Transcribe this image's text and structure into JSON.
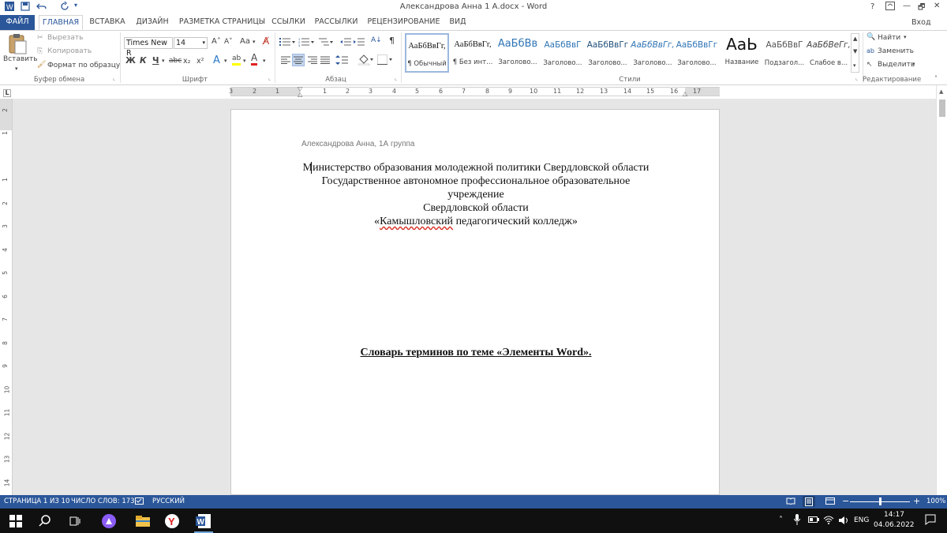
{
  "window": {
    "title": "Александрова Анна 1 А.docx - Word",
    "help": "?",
    "minimize": "—",
    "restore": "🗗",
    "close": "✕",
    "sign_in": "Вход"
  },
  "tabs": [
    "ФАЙЛ",
    "ГЛАВНАЯ",
    "ВСТАВКА",
    "ДИЗАЙН",
    "РАЗМЕТКА СТРАНИЦЫ",
    "ССЫЛКИ",
    "РАССЫЛКИ",
    "РЕЦЕНЗИРОВАНИЕ",
    "ВИД"
  ],
  "clipboard": {
    "paste": "Вставить",
    "cut": "Вырезать",
    "copy": "Копировать",
    "format_painter": "Формат по образцу",
    "label": "Буфер обмена"
  },
  "font": {
    "name": "Times New R",
    "size": "14",
    "grow": "A˄",
    "shrink": "A˅",
    "case": "Aa",
    "bold": "Ж",
    "italic": "К",
    "underline": "Ч",
    "strike": "abc",
    "subscript": "x₂",
    "superscript": "x²",
    "effects": "A",
    "highlight": "ab",
    "color": "A",
    "label": "Шрифт"
  },
  "paragraph": {
    "label": "Абзац",
    "pilcrow": "¶",
    "sort": "A↓"
  },
  "styles": {
    "label": "Стили",
    "items": [
      {
        "sample": "АаБбВвГг,",
        "name": "¶ Обычный"
      },
      {
        "sample": "АаБбВвГг,",
        "name": "¶ Без инт..."
      },
      {
        "sample": "АаБбВв",
        "name": "Заголово..."
      },
      {
        "sample": "АаБбВвГ",
        "name": "Заголово..."
      },
      {
        "sample": "АаБбВвГг",
        "name": "Заголово..."
      },
      {
        "sample": "АаБбВвГг,",
        "name": "Заголово..."
      },
      {
        "sample": "АаБбВвГг",
        "name": "Заголово..."
      },
      {
        "sample": "АаЬ",
        "name": "Название"
      },
      {
        "sample": "АаБбВвГ",
        "name": "Подзагол..."
      },
      {
        "sample": "АаБбВеГг,",
        "name": "Слабое в..."
      }
    ]
  },
  "editing": {
    "find": "Найти",
    "replace": "Заменить",
    "select": "Выделить",
    "label": "Редактирование"
  },
  "ruler": {
    "h_numbers": [
      "3",
      "2",
      "1",
      "1",
      "1",
      "2",
      "3",
      "4",
      "5",
      "6",
      "7",
      "8",
      "9",
      "10",
      "11",
      "12",
      "13",
      "14",
      "15",
      "16",
      "17"
    ],
    "v_numbers": [
      "2",
      "1",
      "1",
      "2",
      "3",
      "4",
      "5",
      "6",
      "7",
      "8",
      "9",
      "10",
      "11",
      "12",
      "13",
      "14"
    ],
    "corner": "L"
  },
  "document": {
    "header": "Александрова Анна, 1А группа",
    "line1": "Министерство образования молодежной политики Свердловской области",
    "line2": "Государственное автономное профессиональное образовательное",
    "line3": "учреждение",
    "line4": "Свердловской области",
    "line5_open": "«",
    "line5_misspelled": "Камышловский",
    "line5_rest": " педагогический колледж»",
    "title": "Словарь терминов по теме «Элементы Word»."
  },
  "status": {
    "page": "СТРАНИЦА 1 ИЗ 10",
    "words": "ЧИСЛО СЛОВ: 173",
    "language": "РУССКИЙ",
    "zoom": "100%",
    "zoom_level": 1.0
  },
  "taskbar": {
    "lang": "ENG",
    "time": "14:17",
    "date": "04.06.2022"
  },
  "colors": {
    "accent": "#2b579a",
    "taskbar": "#101010"
  }
}
